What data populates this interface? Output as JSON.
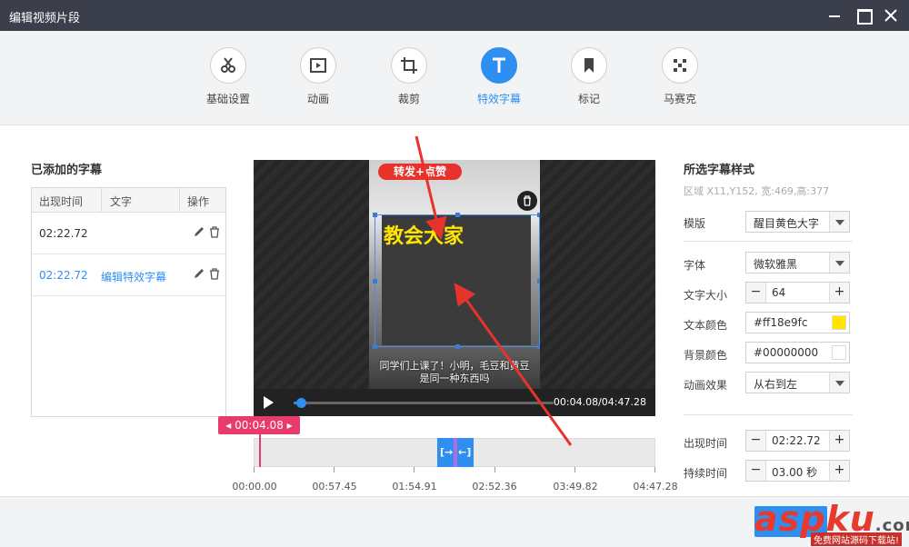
{
  "window": {
    "title": "编辑视频片段"
  },
  "toolbar": {
    "items": [
      {
        "label": "基础设置",
        "icon": "scissors-icon"
      },
      {
        "label": "动画",
        "icon": "play-frame-icon"
      },
      {
        "label": "裁剪",
        "icon": "crop-icon"
      },
      {
        "label": "特效字幕",
        "icon": "text-icon",
        "active": true
      },
      {
        "label": "标记",
        "icon": "bookmark-icon"
      },
      {
        "label": "马赛克",
        "icon": "mosaic-icon"
      }
    ]
  },
  "subtitles": {
    "title": "已添加的字幕",
    "columns": [
      "出现时间",
      "文字",
      "操作"
    ],
    "rows": [
      {
        "time": "02:22.72",
        "text": ""
      },
      {
        "time": "02:22.72",
        "text": "编辑特效字幕"
      }
    ]
  },
  "preview": {
    "badge_text": "转发+点赞",
    "overlay_text": "教会大家",
    "caption_line1": "同学们上课了！小明，毛豆和黄豆",
    "caption_line2": "是同一种东西吗"
  },
  "player": {
    "time_display": "00:04.08/04:47.28",
    "progress_fraction": 0.014
  },
  "timeline": {
    "playhead": "00:04.08",
    "ticks": [
      "00:00.00",
      "00:57.45",
      "01:54.91",
      "02:52.36",
      "03:49.82",
      "04:47.28"
    ],
    "clip_start_icon": "[→",
    "clip_end_icon": "←]"
  },
  "style_panel": {
    "title": "所选字幕样式",
    "region": "区域 X11,Y152, 宽:469,高:377",
    "template_label": "模版",
    "template_value": "醒目黄色大字",
    "font_label": "字体",
    "font_value": "微软雅黑",
    "size_label": "文字大小",
    "size_value": "64",
    "text_color_label": "文本颜色",
    "text_color_value": "#ff18e9fc",
    "text_color_swatch": "#ffe500",
    "bg_color_label": "背景颜色",
    "bg_color_value": "#00000000",
    "bg_color_swatch": "#ffffff",
    "anim_label": "动画效果",
    "anim_value": "从右到左",
    "appear_label": "出现时间",
    "appear_value": "02:22.72",
    "duration_label": "持续时间",
    "duration_value": "03.00 秒"
  },
  "watermark": {
    "logo": "aspku",
    "domain": ".com",
    "tagline": "免费网站源码下载站!"
  },
  "colors": {
    "accent": "#2e8ff0",
    "titlebar": "#3a3f4b",
    "playhead": "#e83b6b",
    "arrow": "#e8332c"
  }
}
